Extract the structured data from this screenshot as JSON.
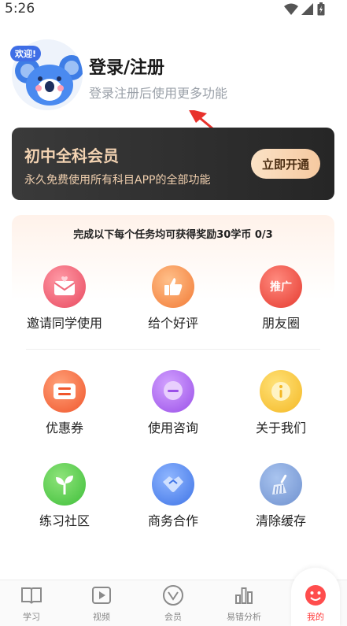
{
  "status_bar": {
    "time": "5:26"
  },
  "profile": {
    "welcome_badge": "欢迎!",
    "title": "登录/注册",
    "subtitle": "登录注册后使用更多功能"
  },
  "vip_card": {
    "title": "初中全科会员",
    "subtitle": "永久免费使用所有科目APP的全部功能",
    "button_label": "立即开通"
  },
  "tasks": {
    "header": "完成以下每个任务均可获得奖励30学币 0/3",
    "items": [
      {
        "label": "邀请同学使用",
        "icon": "invite-envelope-icon"
      },
      {
        "label": "给个好评",
        "icon": "thumbs-up-icon"
      },
      {
        "label": "朋友圈",
        "icon": "promote-icon",
        "icon_text": "推广"
      }
    ]
  },
  "features": {
    "items": [
      {
        "label": "优惠券",
        "icon": "coupon-icon"
      },
      {
        "label": "使用咨询",
        "icon": "chat-bubble-icon"
      },
      {
        "label": "关于我们",
        "icon": "info-icon"
      },
      {
        "label": "练习社区",
        "icon": "sprout-icon"
      },
      {
        "label": "商务合作",
        "icon": "handshake-icon"
      },
      {
        "label": "清除缓存",
        "icon": "broom-icon"
      }
    ]
  },
  "bottom_nav": {
    "items": [
      {
        "label": "学习",
        "icon": "book-icon"
      },
      {
        "label": "视频",
        "icon": "video-play-icon"
      },
      {
        "label": "会员",
        "icon": "vip-icon"
      },
      {
        "label": "易错分析",
        "icon": "bar-chart-icon"
      },
      {
        "label": "我的",
        "icon": "smiley-icon",
        "active": true
      }
    ]
  },
  "colors": {
    "accent_red": "#ff3b3b",
    "vip_dark": "#2e2e2e",
    "vip_gold": "#f3d3b2"
  }
}
